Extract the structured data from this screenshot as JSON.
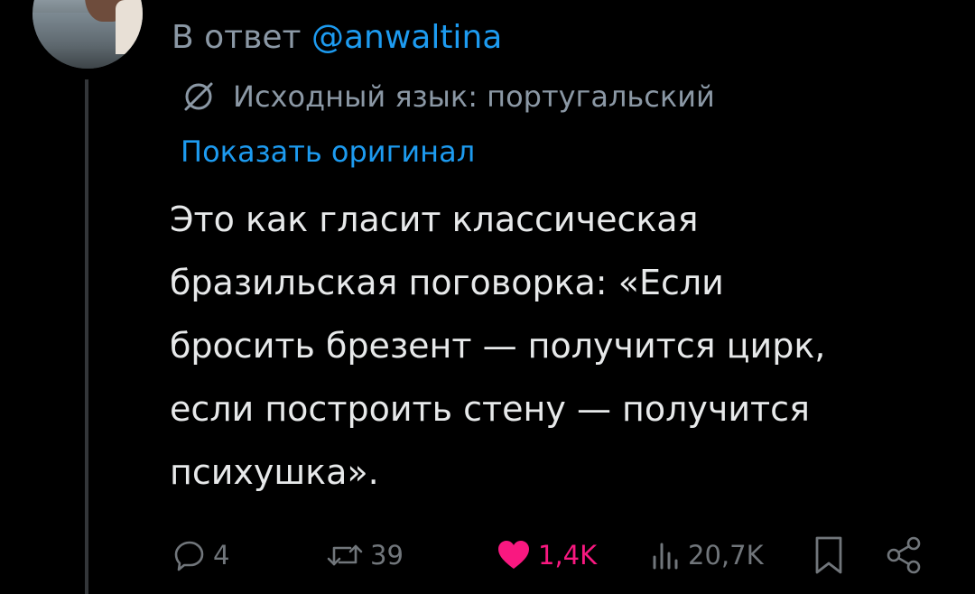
{
  "reply": {
    "prefix": "В ответ",
    "handle": "@anwaltina"
  },
  "translation": {
    "icon": "translate-icon",
    "note": "Исходный язык: португальский",
    "show_original": "Показать оригинал"
  },
  "tweet": {
    "text": "Это как гласит классическая\nбразильская поговорка: «Если\nбросить брезент — получится цирк,\nесли построить стену — получится\nпсихушка»."
  },
  "actions": {
    "replies": "4",
    "retweets": "39",
    "likes": "1,4K",
    "views": "20,7K"
  },
  "colors": {
    "background": "#000000",
    "text": "#e7e9ea",
    "secondary": "#8b98a5",
    "link": "#1d9bf0",
    "like": "#f91880"
  }
}
